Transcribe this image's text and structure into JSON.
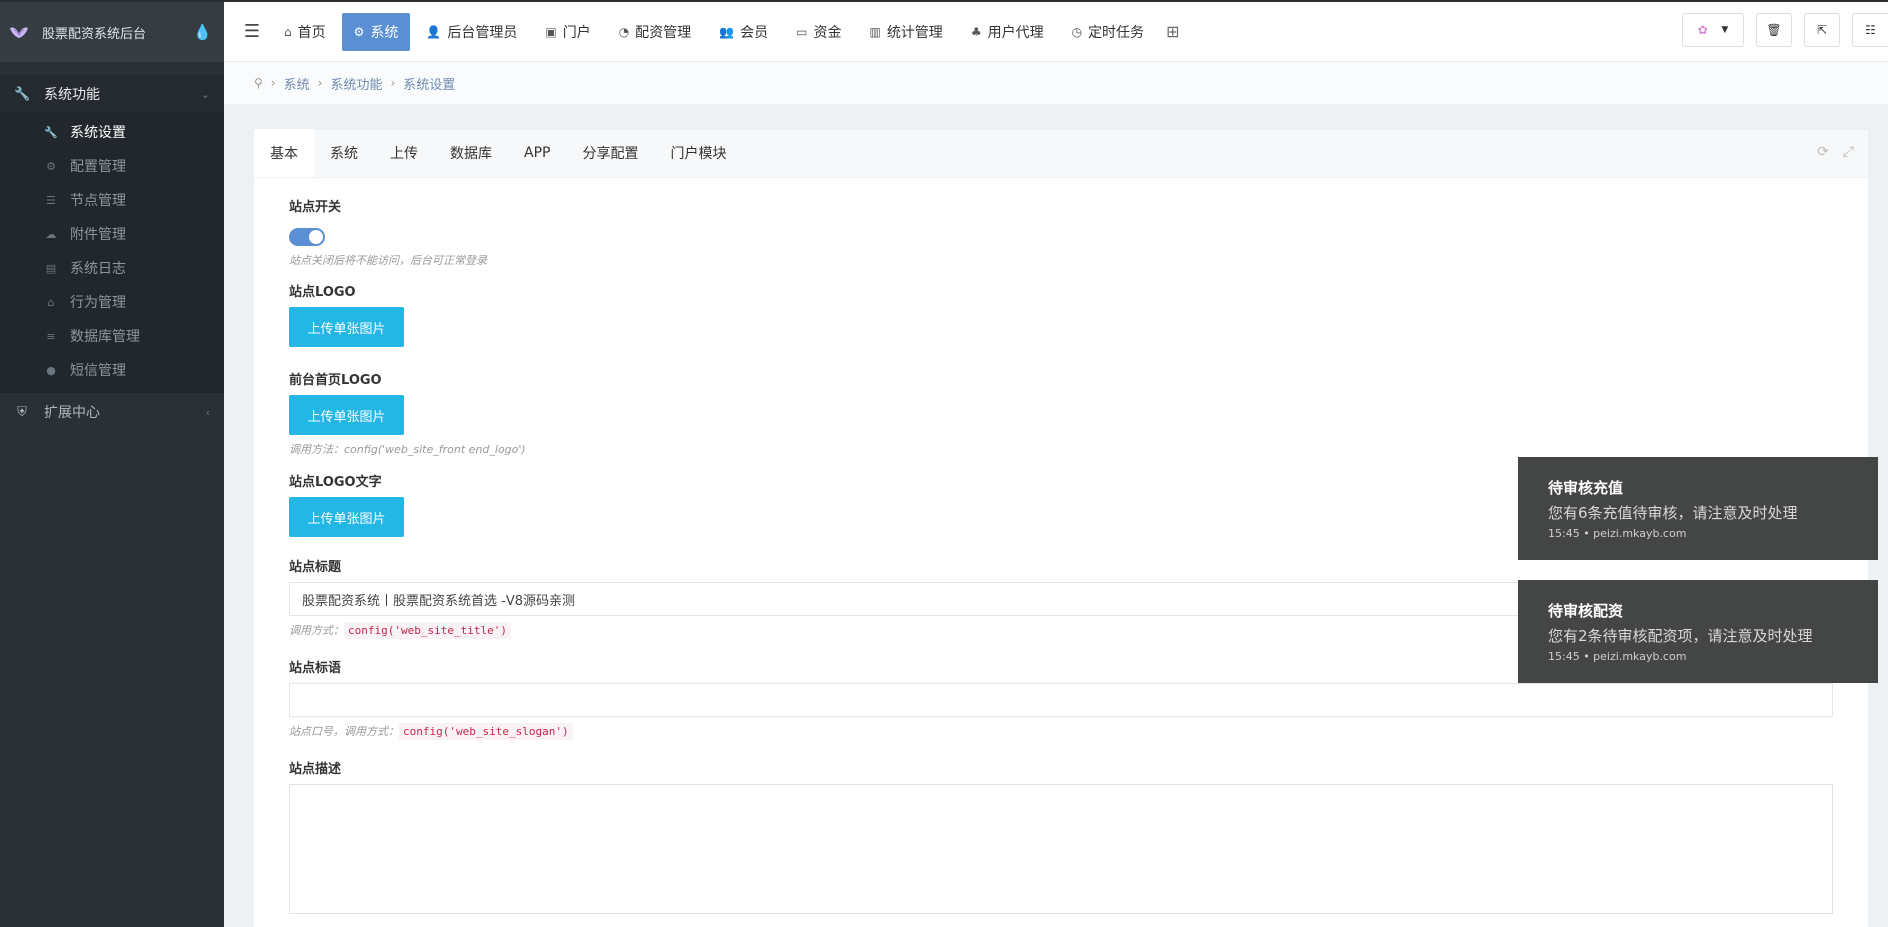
{
  "sidebar": {
    "brand": "股票配资系统后台",
    "groups": [
      {
        "label": "系统功能",
        "icon": "wrench-icon"
      },
      {
        "label": "扩展中心",
        "icon": "shield-icon"
      }
    ],
    "items": [
      {
        "label": "系统设置",
        "icon": "wrench-icon",
        "active": true
      },
      {
        "label": "配置管理",
        "icon": "cogs-icon"
      },
      {
        "label": "节点管理",
        "icon": "list-icon"
      },
      {
        "label": "附件管理",
        "icon": "cloud-upload-icon"
      },
      {
        "label": "系统日志",
        "icon": "book-icon"
      },
      {
        "label": "行为管理",
        "icon": "bank-icon"
      },
      {
        "label": "数据库管理",
        "icon": "database-icon"
      },
      {
        "label": "短信管理",
        "icon": "comment-icon"
      }
    ]
  },
  "topnav": {
    "items": [
      {
        "label": "首页",
        "icon": "home-icon"
      },
      {
        "label": "系统",
        "icon": "gear-icon",
        "active": true
      },
      {
        "label": "后台管理员",
        "icon": "user-icon"
      },
      {
        "label": "门户",
        "icon": "newspaper-icon"
      },
      {
        "label": "配资管理",
        "icon": "pie-chart-icon"
      },
      {
        "label": "会员",
        "icon": "users-icon"
      },
      {
        "label": "资金",
        "icon": "money-icon"
      },
      {
        "label": "统计管理",
        "icon": "bar-chart-icon"
      },
      {
        "label": "用户代理",
        "icon": "sitemap-icon"
      },
      {
        "label": "定时任务",
        "icon": "clock-icon"
      }
    ]
  },
  "breadcrumb": [
    "系统",
    "系统功能",
    "系统设置"
  ],
  "tabs": [
    "基本",
    "系统",
    "上传",
    "数据库",
    "APP",
    "分享配置",
    "门户模块"
  ],
  "form": {
    "site_switch": {
      "label": "站点开关",
      "help": "站点关闭后将不能访问，后台可正常登录"
    },
    "site_logo": {
      "label": "站点LOGO",
      "button": "上传单张图片"
    },
    "front_logo": {
      "label": "前台首页LOGO",
      "button": "上传单张图片",
      "help": "调用方法：config('web_site_front end_logo')"
    },
    "logo_text": {
      "label": "站点LOGO文字",
      "button": "上传单张图片"
    },
    "site_title": {
      "label": "站点标题",
      "value": "股票配资系统丨股票配资系统首选 -V8源码亲测",
      "help_prefix": "调用方式：",
      "help_code": "config('web_site_title')"
    },
    "site_slogan": {
      "label": "站点标语",
      "value": "",
      "help_prefix": "站点口号，调用方式：",
      "help_code": "config('web_site_slogan')"
    },
    "site_desc": {
      "label": "站点描述"
    }
  },
  "toasts": [
    {
      "title": "待审核充值",
      "message": "您有6条充值待审核，请注意及时处理",
      "meta": "15:45 • peizi.mkayb.com"
    },
    {
      "title": "待审核配资",
      "message": "您有2条待审核配资项，请注意及时处理",
      "meta": "15:45 • peizi.mkayb.com"
    }
  ]
}
